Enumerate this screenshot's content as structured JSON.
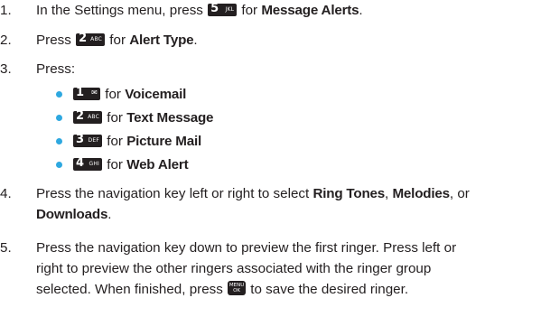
{
  "steps": [
    {
      "n": "1.",
      "a": "In the Settings menu, press",
      "key": "5",
      "key_letters": "JKL",
      "b": "for",
      "bold": "Message Alerts",
      "c": "."
    },
    {
      "n": "2.",
      "a": "Press",
      "key": "2",
      "key_letters": "ABC",
      "b": "for",
      "bold": "Alert Type",
      "c": "."
    },
    {
      "n": "3.",
      "a": "Press:"
    },
    {
      "n": "4.",
      "a": "Press the navigation key left or right to select",
      "b1": "Ring Tones",
      "s1": ",",
      "b2": "Melodies",
      "s2": ", or",
      "b3": "Downloads",
      "s3": "."
    },
    {
      "n": "5.",
      "line1": "Press the navigation key down to preview the first ringer. Press left or",
      "line2": "right to preview the other ringers associated with the ringer group",
      "line3a": "selected. When finished, press",
      "menu_key": {
        "top": "MENU",
        "bottom": "OK"
      },
      "line3b": "to save the desired ringer."
    }
  ],
  "substeps": [
    {
      "key": "1",
      "key_letters": "✉",
      "for": "for",
      "bold": "Voicemail"
    },
    {
      "key": "2",
      "key_letters": "ABC",
      "for": "for",
      "bold": "Text Message"
    },
    {
      "key": "3",
      "key_letters": "DEF",
      "for": "for",
      "bold": "Picture Mail"
    },
    {
      "key": "4",
      "key_letters": "GHI",
      "for": "for",
      "bold": "Web Alert"
    }
  ],
  "colors": {
    "bullet": "#2ea8e0",
    "text": "#231f20",
    "key_bg": "#231f20"
  }
}
